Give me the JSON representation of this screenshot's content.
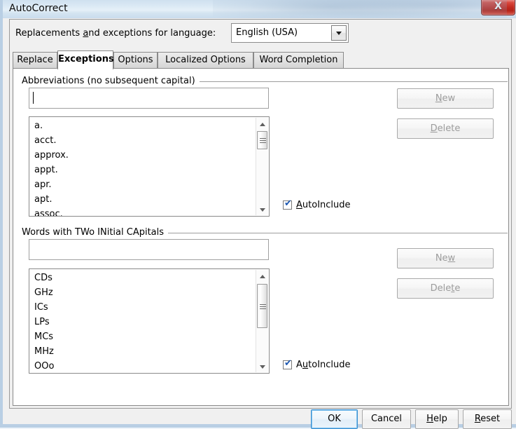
{
  "window": {
    "title": "AutoCorrect",
    "close_label": "X"
  },
  "language_row": {
    "label_pre": "Replacements ",
    "label_acc": "a",
    "label_post": "nd exceptions for language:",
    "selected": "English (USA)",
    "dropdown_icon": "chevron-down-icon"
  },
  "tabs": [
    {
      "label": "Replace",
      "active": false
    },
    {
      "label": "Exceptions",
      "active": true
    },
    {
      "label": "Options",
      "active": false
    },
    {
      "label": "Localized Options",
      "active": false
    },
    {
      "label": "Word Completion",
      "active": false
    }
  ],
  "abbreviations": {
    "group_label": "Abbreviations (no subsequent capital)",
    "input_value": "",
    "input_placeholder": "",
    "items": [
      "a.",
      "acct.",
      "approx.",
      "appt.",
      "apr.",
      "apt.",
      "assoc."
    ],
    "new_button": {
      "pre": "",
      "acc": "N",
      "post": "ew",
      "disabled": true
    },
    "delete_button": {
      "pre": "",
      "acc": "D",
      "post": "elete",
      "disabled": true
    },
    "autoinclude": {
      "label_pre": "",
      "label_acc": "A",
      "label_post": "utoInclude",
      "checked": true,
      "tick": "✔"
    }
  },
  "two_initial_capitals": {
    "group_label": "Words with TWo INitial CApitals",
    "input_value": "",
    "input_placeholder": "",
    "items": [
      "CDs",
      "GHz",
      "ICs",
      "LPs",
      "MCs",
      "MHz",
      "OOo"
    ],
    "new_button": {
      "pre": "Ne",
      "acc": "w",
      "post": "",
      "disabled": true
    },
    "delete_button": {
      "pre": "Dele",
      "acc": "t",
      "post": "e",
      "disabled": true
    },
    "autoinclude": {
      "label_pre": "A",
      "label_acc": "u",
      "label_post": "toInclude",
      "checked": true,
      "tick": "✔"
    }
  },
  "footer": {
    "ok": {
      "pre": "OK",
      "acc": "",
      "post": "",
      "primary": true
    },
    "cancel": {
      "pre": "Cancel",
      "acc": "",
      "post": ""
    },
    "help": {
      "pre": "",
      "acc": "H",
      "post": "elp"
    },
    "reset": {
      "pre": "",
      "acc": "R",
      "post": "eset"
    }
  },
  "colors": {
    "titlebar_start": "#cfe0ef",
    "titlebar_end": "#c9dced",
    "close_red": "#c32a20",
    "dialog_bg": "#f0f0f0",
    "page_bg": "#ffffff",
    "focus_blue": "#3c8fd0",
    "check_blue": "#1a56b0",
    "border_gray": "#8a8a8a"
  }
}
